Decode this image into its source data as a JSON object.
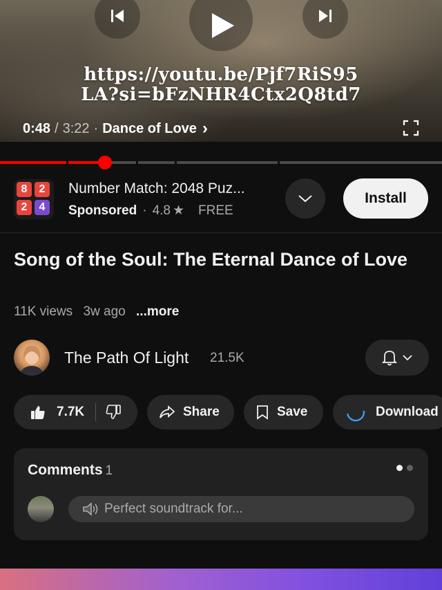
{
  "player": {
    "overlay_url_line1": "https://youtu.be/Pjf7RiS95",
    "overlay_url_line2": "LA?si=bFzNHR4Ctx2Q8td7",
    "current_time": "0:48",
    "separator": "/",
    "duration": "3:22",
    "dot": "·",
    "chapter": "Dance of Love",
    "chapter_chevron": "›",
    "progress_fraction": 0.238,
    "icons": [
      "previous-icon",
      "play-icon",
      "next-icon",
      "fullscreen-icon"
    ]
  },
  "ad": {
    "title": "Number Match: 2048 Puz...",
    "sponsored": "Sponsored",
    "dot": "·",
    "rating": "4.8",
    "star": "★",
    "price": "FREE",
    "install_label": "Install",
    "logo_tiles": [
      {
        "text": "8",
        "color": "#e8453c"
      },
      {
        "text": "2",
        "color": "#e8453c"
      },
      {
        "text": "2",
        "color": "#e8453c"
      },
      {
        "text": "4",
        "color": "#7a4bd0"
      }
    ]
  },
  "video": {
    "title": "Song of the Soul: The Eternal Dance of Love",
    "views": "11K views",
    "age": "3w ago",
    "more": "...more"
  },
  "channel": {
    "name": "The Path Of Light",
    "subscribers": "21.5K"
  },
  "actions": {
    "likes": "7.7K",
    "share": "Share",
    "save": "Save",
    "download": "Download"
  },
  "comments": {
    "heading": "Comments",
    "count": "1",
    "preview": "Perfect soundtrack for..."
  },
  "colors": {
    "accent_red": "#ff0000",
    "background": "#0f0f0f",
    "surface": "#272727",
    "download_spinner": "#3ea6ff"
  }
}
